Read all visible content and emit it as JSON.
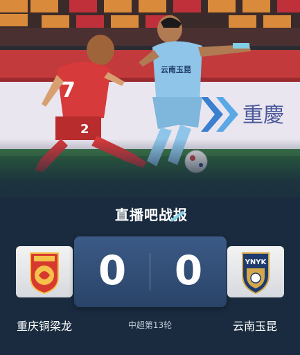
{
  "brand": {
    "title": "直播吧战报"
  },
  "match": {
    "home": {
      "name": "重庆铜梁龙",
      "score": "0",
      "logo": "chongqing-tongliang-dragon-crest"
    },
    "away": {
      "name": "云南玉昆",
      "score": "0",
      "logo": "yunnan-yukun-crest",
      "logo_text": "YNYK"
    },
    "round": "中超第13轮"
  },
  "photo": {
    "banner_text": "重慶",
    "shirt_text": "云南玉昆",
    "home_shirt_number": "7",
    "home_shorts_number": "2"
  },
  "colors": {
    "background": "#1a2b3f",
    "score_panel": "#2f4c74",
    "home_red": "#d63a3a",
    "away_sky": "#8ec5e8"
  }
}
